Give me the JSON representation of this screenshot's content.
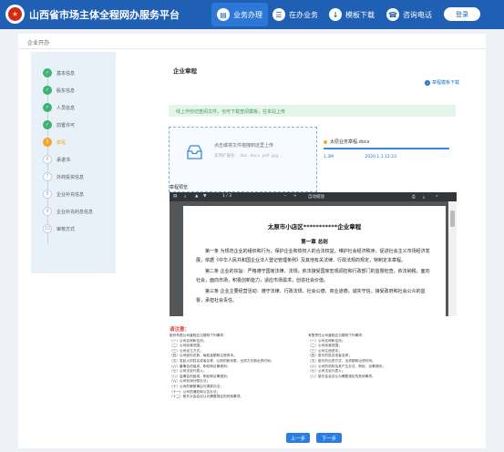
{
  "header": {
    "site_title": "山西省市场主体全程网办服务平台",
    "logo_glyph": "★",
    "nav": [
      {
        "label": "业务办理",
        "icon": "document-icon",
        "active": true
      },
      {
        "label": "在办业务",
        "icon": "list-icon",
        "active": false
      },
      {
        "label": "模板下载",
        "icon": "download-icon",
        "active": false
      },
      {
        "label": "咨询电话",
        "icon": "phone-icon",
        "active": false
      }
    ],
    "login_label": "登录"
  },
  "breadcrumb": "企业开办",
  "steps": [
    {
      "label": "基本信息",
      "state": "done",
      "marker": "✓"
    },
    {
      "label": "股东信息",
      "state": "done",
      "marker": "✓"
    },
    {
      "label": "人员信息",
      "state": "done",
      "marker": "✓"
    },
    {
      "label": "前置许可",
      "state": "done",
      "marker": "✓"
    },
    {
      "label": "章程",
      "state": "current",
      "marker": "5"
    },
    {
      "label": "承诺书",
      "state": "todo",
      "marker": "6"
    },
    {
      "label": "外商投资信息",
      "state": "todo",
      "marker": "7"
    },
    {
      "label": "企业补充信息",
      "state": "todo",
      "marker": "8"
    },
    {
      "label": "企业补充利息信息",
      "state": "todo",
      "marker": "9"
    },
    {
      "label": "审核方式",
      "state": "todo",
      "marker": "10"
    }
  ],
  "main": {
    "title": "企业章程",
    "download_link": "章程模板下载",
    "notice": "线上作份切查阅文件，也可下载查阅模板，在本站上传",
    "upload": {
      "line1": "点击或将文件拖拽到这里上传",
      "line2": "支持扩展名：.doc .docx .pdf .jpg..."
    },
    "file": {
      "name": "太原业务章程.docx",
      "size": "1.3M",
      "date": "2020.1.1 12:23",
      "progress": 1.0
    },
    "preview_label": "章程预览"
  },
  "viewer": {
    "page_indicator": "1 / 3",
    "zoom": "自动缩放",
    "doc_title": "太原市小店区***********企业章程",
    "chapter": "第一章  总则",
    "paragraphs": [
      "第一条 为规范企业的组织和行为，保护企业和债权人的合法权益，维护社会经济秩序，促进社会主义市场经济发展，依据《中华人民共和国企业法人登记管理条例》及其他有关法律、行政法规的规定，特制定本章程。",
      "第二条 企业的宗旨：严格遵守国家法律、法规，依法接受国家宏观调控和行政部门的监督检查，依法纳税，面向社会，面向市场，积极创新能力，适应市场需求，创造社会价值。",
      "第三条 企业主要经营活动：遵守法律、行政法规、社会公德、商业道德，诚实守信，接受政府和社会公众的监督，承担社会责任。"
    ]
  },
  "notes": {
    "title": "请注意：",
    "left": [
      "股份有限公司章程应当载明下列事项：",
      "（一）公司名称和住所；",
      "（二）公司经营范围；",
      "（三）公司设立方式；",
      "（四）公司股份总数、每股金额和注册资本；",
      "（五）发起人的姓名或者名称、认购的股份数、出资方式和出资时间；",
      "（六）董事会的组成、职权和议事规则；",
      "（七）公司法定代表人；",
      "（八）监事会的组成、职权和议事规则；",
      "（九）公司利润分配办法；",
      "（十）公司的解散事由与清算办法；",
      "（十一）公司的通知和公告办法；",
      "（十二）股东大会会议认为需要规定的其他事项。"
    ],
    "right": [
      "有限责任公司章程应当载明下列事项：",
      "（一）公司名称和住所；",
      "（二）公司经营范围；",
      "（三）公司注册资本；",
      "（四）股东的姓名或者名称；",
      "（五）股东的出资方式、出资额和出资时间；",
      "（六）公司的机构及其产生办法、职权、议事规则；",
      "（七）公司法定代表人；",
      "（八）股东会会议认为需要规定的其他事项。"
    ]
  },
  "buttons": {
    "prev": "上一步",
    "next": "下一步"
  }
}
